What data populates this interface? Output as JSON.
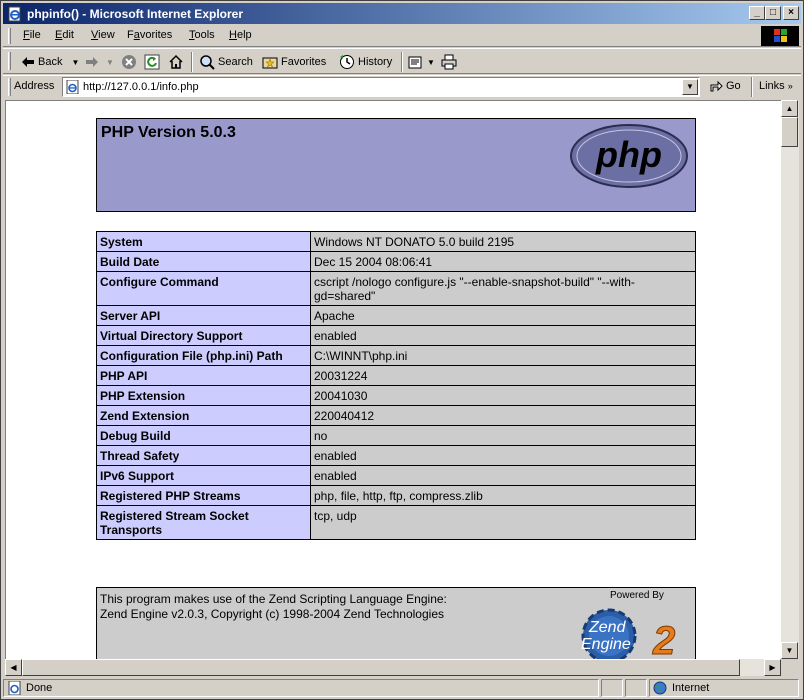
{
  "window": {
    "title": "phpinfo() - Microsoft Internet Explorer",
    "min_label": "_",
    "max_label": "□",
    "close_label": "×"
  },
  "menu": {
    "items": [
      {
        "first": "F",
        "rest": "ile"
      },
      {
        "first": "E",
        "rest": "dit"
      },
      {
        "first": "V",
        "rest": "iew"
      },
      {
        "first": "F",
        "rest": "avorites",
        "alt": "a"
      },
      {
        "first": "T",
        "rest": "ools"
      },
      {
        "first": "H",
        "rest": "elp"
      }
    ]
  },
  "toolbar": {
    "back_label": "Back",
    "search_label": "Search",
    "favorites_label": "Favorites",
    "history_label": "History"
  },
  "address": {
    "label": "Address",
    "url": "http://127.0.0.1/info.php",
    "go_label": "Go",
    "links_label": "Links"
  },
  "page": {
    "version_heading": "PHP Version 5.0.3",
    "logo_text": "php",
    "rows": [
      {
        "key": "System",
        "value": "Windows NT DONATO 5.0 build 2195"
      },
      {
        "key": "Build Date",
        "value": "Dec 15 2004 08:06:41"
      },
      {
        "key": "Configure Command",
        "value": "cscript /nologo configure.js \"--enable-snapshot-build\" \"--with-gd=shared\""
      },
      {
        "key": "Server API",
        "value": "Apache"
      },
      {
        "key": "Virtual Directory Support",
        "value": "enabled"
      },
      {
        "key": "Configuration File (php.ini) Path",
        "value": "C:\\WINNT\\php.ini"
      },
      {
        "key": "PHP API",
        "value": "20031224"
      },
      {
        "key": "PHP Extension",
        "value": "20041030"
      },
      {
        "key": "Zend Extension",
        "value": "220040412"
      },
      {
        "key": "Debug Build",
        "value": "no"
      },
      {
        "key": "Thread Safety",
        "value": "enabled"
      },
      {
        "key": "IPv6 Support",
        "value": "enabled"
      },
      {
        "key": "Registered PHP Streams",
        "value": "php, file, http, ftp, compress.zlib"
      },
      {
        "key": "Registered Stream Socket Transports",
        "value": "tcp, udp"
      }
    ],
    "zend_line1": "This program makes use of the Zend Scripting Language Engine:",
    "zend_line2": "Zend Engine v2.0.3, Copyright (c) 1998-2004 Zend Technologies",
    "powered_by": "Powered By",
    "zend_logo_word1": "Zend",
    "zend_logo_word2": "Engine",
    "zend_logo_num": "2"
  },
  "status": {
    "text": "Done",
    "zone": "Internet"
  },
  "colors": {
    "title_gradient_start": "#0a246a",
    "title_gradient_end": "#a6caf0",
    "php_header_bg": "#9999cc",
    "key_cell_bg": "#ccccff",
    "value_cell_bg": "#cccccc"
  }
}
